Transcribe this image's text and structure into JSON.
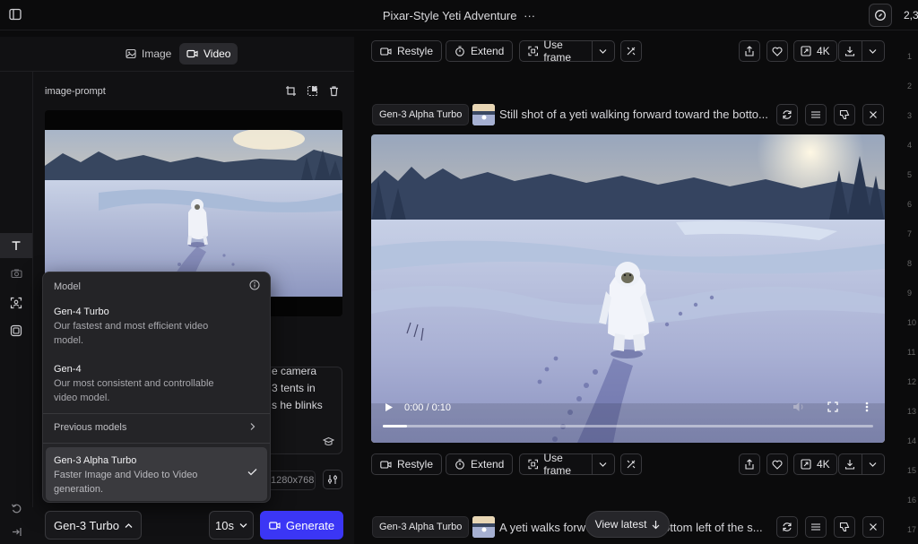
{
  "app": {
    "title": "Pixar-Style Yeti Adventure",
    "title_more": "···",
    "credits": "2,3"
  },
  "left": {
    "tabs": [
      {
        "label": "Image"
      },
      {
        "label": "Video"
      }
    ],
    "image_prompt_label": "image-prompt",
    "prompt_fragments": [
      "e camera",
      "3 tents in",
      "s he blinks"
    ],
    "resolution": "1280x768",
    "model_selected": "Gen-3 Turbo",
    "duration": "10s",
    "generate_label": "Generate"
  },
  "dropdown": {
    "title": "Model",
    "models": [
      {
        "name": "Gen-4 Turbo",
        "desc_line1": "Our fastest and most efficient video",
        "desc_line2": "model."
      },
      {
        "name": "Gen-4",
        "desc_line1": "Our most consistent and controllable",
        "desc_line2": "video model."
      }
    ],
    "previous_label": "Previous models",
    "selected": {
      "name": "Gen-3 Alpha Turbo",
      "desc_line1": "Faster Image and Video to Video",
      "desc_line2": "generation."
    }
  },
  "toolbar": {
    "restyle": "Restyle",
    "extend": "Extend",
    "use_frame": "Use frame",
    "quality": "4K"
  },
  "gen1": {
    "model": "Gen-3 Alpha Turbo",
    "prompt": "Still shot of a yeti walking forward toward the botto..."
  },
  "player": {
    "time": "0:00 / 0:10"
  },
  "gen2": {
    "model": "Gen-3 Alpha Turbo",
    "prompt_left": "A yeti walks forw",
    "prompt_right": "ottom left of the s..."
  },
  "view_latest": "View latest",
  "rail_numbers": [
    "1",
    "2",
    "3",
    "4",
    "5",
    "6",
    "7",
    "8",
    "9",
    "10",
    "11",
    "12",
    "13",
    "14",
    "15",
    "16",
    "17"
  ],
  "colors": {
    "accent": "#3b36f5",
    "panel": "#111113",
    "background": "#0b0b0c"
  }
}
